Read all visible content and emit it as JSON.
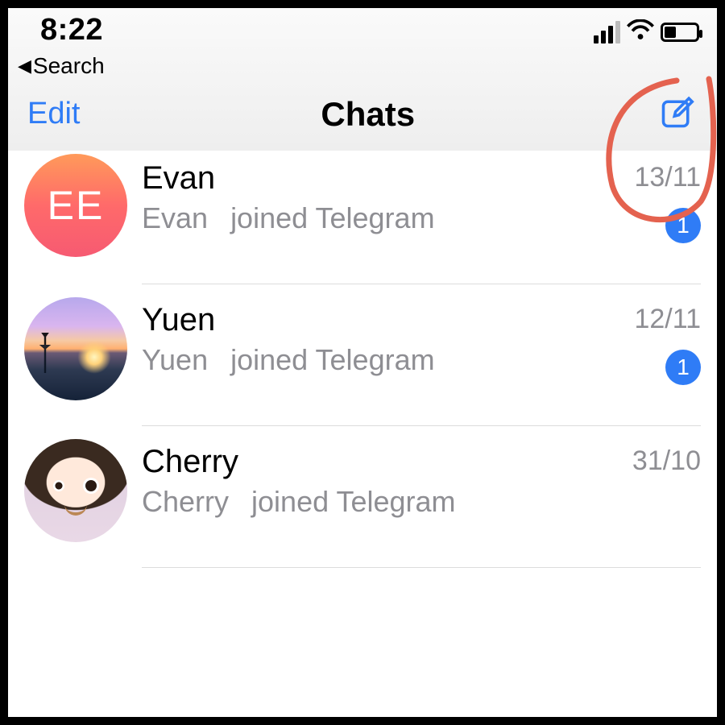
{
  "status": {
    "time": "8:22",
    "back_label": "Search"
  },
  "nav": {
    "edit_label": "Edit",
    "title": "Chats"
  },
  "chats": [
    {
      "name": "Evan",
      "preview_sender": "Evan",
      "preview_text": "joined Telegram",
      "date": "13/11",
      "unread": "1",
      "avatar_kind": "initials",
      "initials": "EE"
    },
    {
      "name": "Yuen",
      "preview_sender": "Yuen",
      "preview_text": "joined Telegram",
      "date": "12/11",
      "unread": "1",
      "avatar_kind": "sunset",
      "initials": ""
    },
    {
      "name": "Cherry",
      "preview_sender": "Cherry",
      "preview_text": "joined Telegram",
      "date": "31/10",
      "unread": "",
      "avatar_kind": "portrait",
      "initials": ""
    }
  ]
}
